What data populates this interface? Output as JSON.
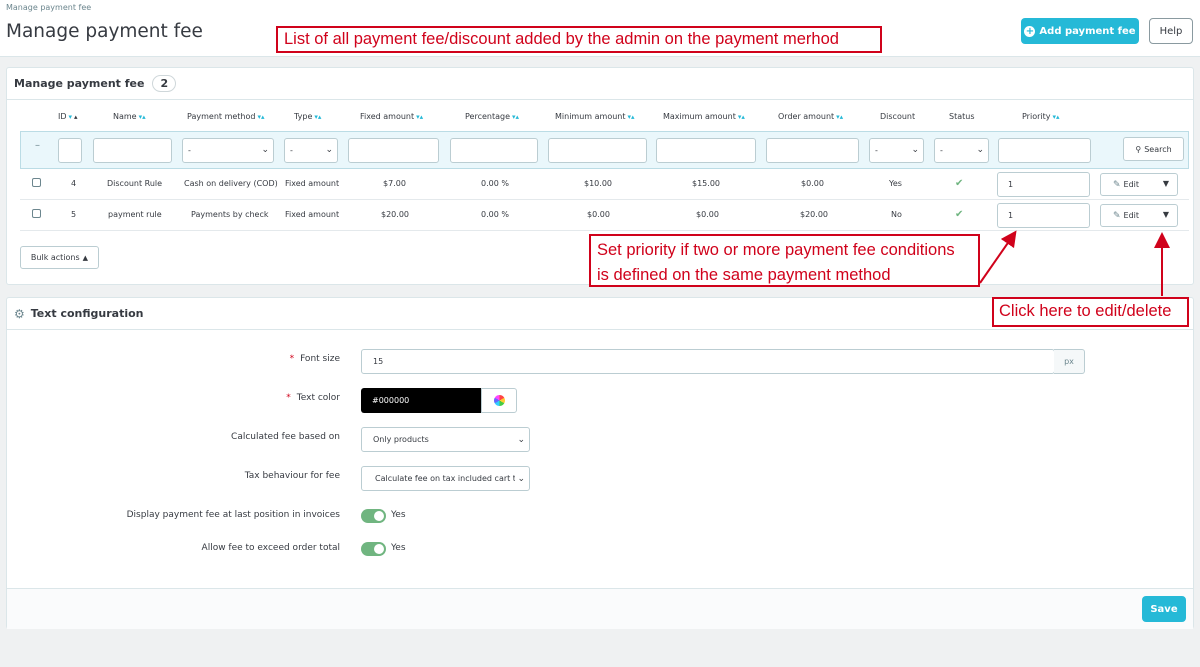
{
  "header": {
    "breadcrumb": "Manage payment fee",
    "title": "Manage payment fee",
    "add_button": "Add payment fee",
    "help_button": "Help"
  },
  "annotations": {
    "list_note": "List of all payment fee/discount added by the admin on the payment merhod",
    "priority_note_line1": "Set priority if two or more payment fee conditions",
    "priority_note_line2": "is defined on the same payment method",
    "edit_note": "Click here to edit/delete"
  },
  "list_panel": {
    "title": "Manage payment fee",
    "count": "2",
    "columns": [
      "ID",
      "Name",
      "Payment method",
      "Type",
      "Fixed amount",
      "Percentage",
      "Minimum amount",
      "Maximum amount",
      "Order amount",
      "Discount",
      "Status",
      "Priority"
    ],
    "filter": {
      "dash": "–",
      "select_placeholder": "-",
      "search_button": "Search"
    },
    "rows": [
      {
        "id": "4",
        "name": "Discount Rule",
        "payment_method": "Cash on delivery (COD)",
        "type": "Fixed amount",
        "fixed_amount": "$7.00",
        "percentage": "0.00 %",
        "minimum_amount": "$10.00",
        "maximum_amount": "$15.00",
        "order_amount": "$0.00",
        "discount": "Yes",
        "status": "enabled",
        "priority": "1",
        "action": "Edit"
      },
      {
        "id": "5",
        "name": "payment rule",
        "payment_method": "Payments by check",
        "type": "Fixed amount",
        "fixed_amount": "$20.00",
        "percentage": "0.00 %",
        "minimum_amount": "$0.00",
        "maximum_amount": "$0.00",
        "order_amount": "$20.00",
        "discount": "No",
        "status": "enabled",
        "priority": "1",
        "action": "Edit"
      }
    ],
    "bulk_actions": "Bulk actions"
  },
  "text_config": {
    "title": "Text configuration",
    "font_size_label": "Font size",
    "font_size_value": "15",
    "font_size_unit": "px",
    "text_color_label": "Text color",
    "text_color_value": "#000000",
    "calc_fee_label": "Calculated fee based on",
    "calc_fee_value": "Only products",
    "tax_label": "Tax behaviour for fee",
    "tax_value": "Calculate fee on tax included cart total",
    "last_position_label": "Display payment fee at last position in invoices",
    "last_position_value": "Yes",
    "exceed_label": "Allow fee to exceed order total",
    "exceed_value": "Yes",
    "save_button": "Save"
  },
  "colors": {
    "primary": "#25b9d7",
    "annotation": "#d0021b",
    "success": "#70b580"
  }
}
